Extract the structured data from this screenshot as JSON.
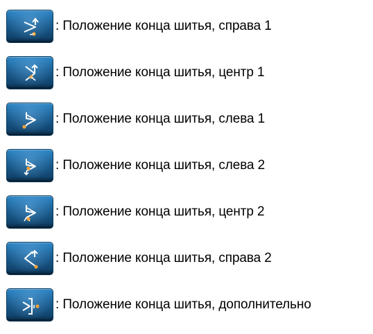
{
  "items": [
    {
      "icon": "end-position-right-1-icon",
      "label": ": Положение конца шитья, справа 1"
    },
    {
      "icon": "end-position-center-1-icon",
      "label": ": Положение конца шитья, центр 1"
    },
    {
      "icon": "end-position-left-1-icon",
      "label": ": Положение конца шитья, слева 1"
    },
    {
      "icon": "end-position-left-2-icon",
      "label": ": Положение конца шитья, слева 2"
    },
    {
      "icon": "end-position-center-2-icon",
      "label": ": Положение конца шитья, центр 2"
    },
    {
      "icon": "end-position-right-2-icon",
      "label": ": Положение конца шитья, справа 2"
    },
    {
      "icon": "end-position-additional-icon",
      "label": ": Положение конца шитья, дополнительно"
    }
  ],
  "colors": {
    "button_top": "#2c86c6",
    "button_bottom": "#0d3a5f",
    "glyph": "#ffffff",
    "marker": "#f2a23a"
  }
}
